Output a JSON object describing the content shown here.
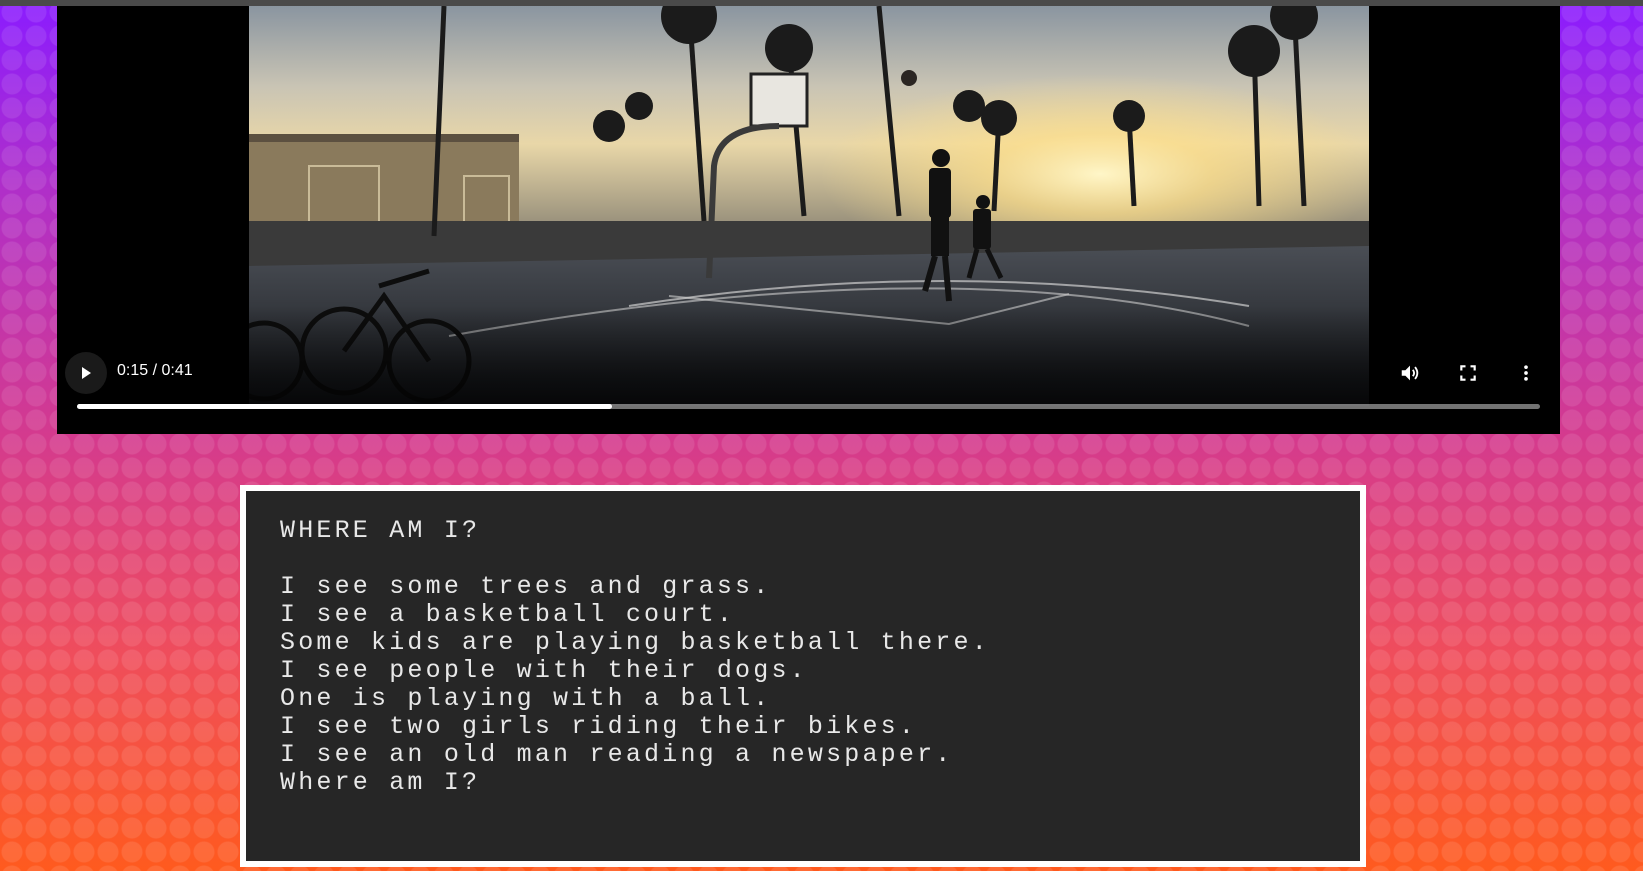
{
  "video": {
    "time_display": "0:15 / 0:41",
    "progress_fraction": 0.366,
    "controls": {
      "play_icon": "play-icon",
      "volume_icon": "volume-icon",
      "fullscreen_icon": "fullscreen-icon",
      "more_icon": "more-options-icon"
    }
  },
  "panel": {
    "heading": "WHERE AM I?",
    "lines": [
      "I see some trees and grass.",
      "I see a basketball court.",
      "Some kids are playing basketball there.",
      "I see people with their dogs.",
      "One is playing with a ball.",
      "I see two girls riding their bikes.",
      "I see an old man reading a newspaper.",
      "Where am I?"
    ]
  }
}
